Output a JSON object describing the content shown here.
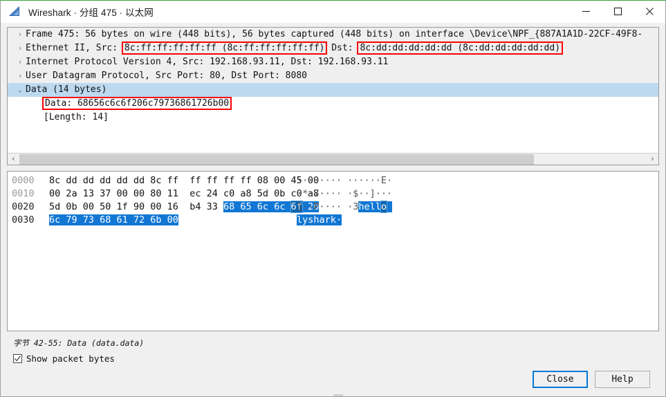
{
  "window": {
    "title": "Wireshark · 分组 475 · 以太网",
    "icon": "wireshark-fin-icon",
    "controls": {
      "minimize": "—",
      "maximize": "□",
      "close": "✕"
    }
  },
  "detail_tree": {
    "rows": [
      {
        "chevron": "›",
        "expanded": false,
        "selected": false,
        "text": "Frame 475: 56 bytes on wire (448 bits), 56 bytes captured (448 bits) on interface \\Device\\NPF_{887A1A1D-22CF-49F8-"
      },
      {
        "chevron": "›",
        "expanded": false,
        "selected": false,
        "prefix": "Ethernet II, Src: ",
        "box1": "8c:ff:ff:ff:ff:ff (8c:ff:ff:ff:ff:ff)",
        "middle": "  Dst: ",
        "box2": "8c:dd:dd:dd:dd:dd (8c:dd:dd:dd:dd:dd)"
      },
      {
        "chevron": "›",
        "expanded": false,
        "selected": false,
        "text": "Internet Protocol Version 4, Src: 192.168.93.11, Dst: 192.168.93.11"
      },
      {
        "chevron": "›",
        "expanded": false,
        "selected": false,
        "text": "User Datagram Protocol, Src Port: 80, Dst Port: 8080"
      },
      {
        "chevron": "⌄",
        "expanded": true,
        "selected": true,
        "text": "Data (14 bytes)"
      },
      {
        "chevron": "",
        "indent": 1,
        "selected": false,
        "boxed": "Data: 68656c6c6f206c79736861726b00"
      },
      {
        "chevron": "",
        "indent": 1,
        "selected": false,
        "text": "[Length: 14]"
      }
    ],
    "scrollbar": {
      "left_arrow": "‹",
      "right_arrow": "›",
      "thumb_percent": 82
    }
  },
  "hex_dump": {
    "rows": [
      {
        "offset": "0000",
        "offset_dark": false,
        "hex_plain_a": "8c dd dd dd dd dd 8c ff",
        "hex_plain_b": "ff ff ff ff 08 00 45 00",
        "hex_sel": "",
        "ascii_plain": "········ ······E·",
        "ascii_sel": ""
      },
      {
        "offset": "0010",
        "offset_dark": false,
        "hex_plain_a": "00 2a 13 37 00 00 80 11",
        "hex_plain_b": "ec 24 c0 a8 5d 0b c0 a8",
        "hex_sel": "",
        "ascii_plain": "·*·7···· ·$··]···",
        "ascii_sel": ""
      },
      {
        "offset": "0020",
        "offset_dark": true,
        "hex_plain_a": "5d 0b 00 50 1f 90 00 16",
        "hex_plain_b": "b4 33 ",
        "hex_sel": "68 65 6c 6c 6f 20",
        "hex_cursor_index": 4,
        "ascii_plain": "]··P···· ·3",
        "ascii_sel": "hello ",
        "ascii_cursor_index": 4
      },
      {
        "offset": "0030",
        "offset_dark": true,
        "hex_plain_a": "",
        "hex_plain_b": "",
        "hex_sel": "6c 79 73 68 61 72 6b 00",
        "ascii_plain": "",
        "ascii_sel": "lyshark·"
      }
    ]
  },
  "status": {
    "text": "字节 42-55: Data (data.data)"
  },
  "options": {
    "show_packet_bytes_label": "Show packet bytes",
    "show_packet_bytes_checked": true
  },
  "footer": {
    "close_label": "Close",
    "help_label": "Help"
  },
  "colors": {
    "selection_blue": "#1277d4",
    "row_select_blue": "#bcd9f0",
    "annotation_red": "#ff0000",
    "focus_blue": "#0078d7",
    "pane_gray": "#efefef"
  }
}
